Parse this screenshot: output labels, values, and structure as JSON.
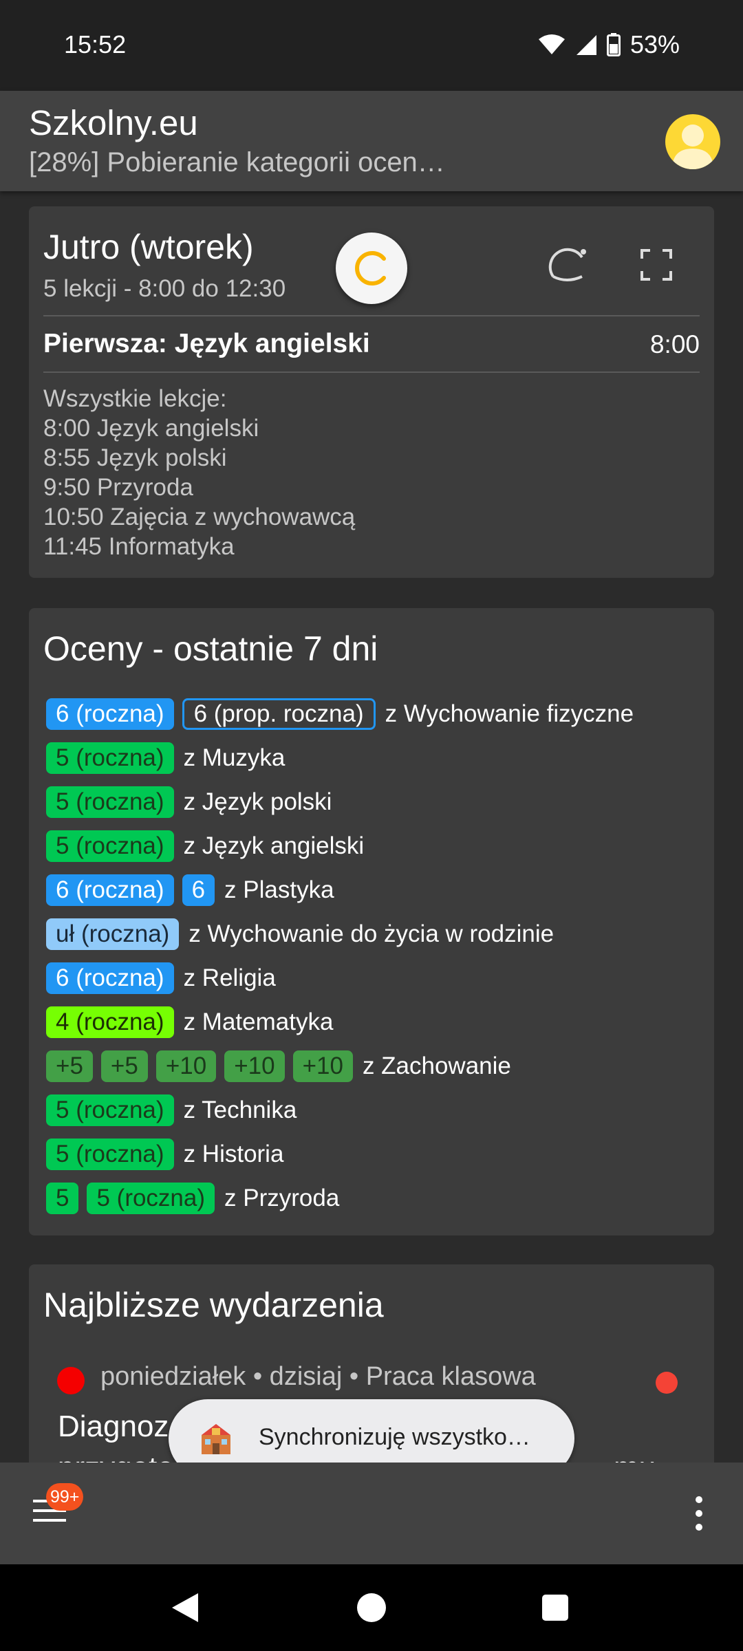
{
  "status_bar": {
    "time": "15:52",
    "battery": "53%"
  },
  "app_bar": {
    "title": "Szkolny.eu",
    "subtitle": "[28%] Pobieranie kategorii ocen…"
  },
  "timetable": {
    "title": "Jutro (wtorek)",
    "summary": "5 lekcji - 8:00 do 12:30",
    "first_label": "Pierwsza: Język angielski",
    "first_time": "8:00",
    "all_lessons_header": "Wszystkie lekcje:",
    "lessons": [
      "8:00 Język angielski",
      "8:55 Język polski",
      "9:50 Przyroda",
      "10:50 Zajęcia z wychowawcą",
      "11:45 Informatyka"
    ]
  },
  "grades": {
    "title": "Oceny - ostatnie 7 dni",
    "rows": [
      {
        "chips": [
          {
            "text": "6 (roczna)",
            "bg": "#2196f3",
            "fg": "#ffffff"
          },
          {
            "text": "6 (prop. roczna)",
            "bg": "outline",
            "fg": "#ffffff"
          }
        ],
        "subject": "z Wychowanie fizyczne"
      },
      {
        "chips": [
          {
            "text": "5 (roczna)",
            "bg": "#00c853",
            "fg": "#1b3a1b"
          }
        ],
        "subject": "z Muzyka"
      },
      {
        "chips": [
          {
            "text": "5 (roczna)",
            "bg": "#00c853",
            "fg": "#1b3a1b"
          }
        ],
        "subject": "z Język polski"
      },
      {
        "chips": [
          {
            "text": "5 (roczna)",
            "bg": "#00c853",
            "fg": "#1b3a1b"
          }
        ],
        "subject": "z Język angielski"
      },
      {
        "chips": [
          {
            "text": "6 (roczna)",
            "bg": "#2196f3",
            "fg": "#ffffff"
          },
          {
            "text": "6",
            "bg": "#2196f3",
            "fg": "#ffffff"
          }
        ],
        "subject": "z Plastyka"
      },
      {
        "chips": [
          {
            "text": "uł (roczna)",
            "bg": "#90caf9",
            "fg": "#1a2a3a"
          }
        ],
        "subject": "z Wychowanie do życia w rodzinie"
      },
      {
        "chips": [
          {
            "text": "6 (roczna)",
            "bg": "#2196f3",
            "fg": "#ffffff"
          }
        ],
        "subject": "z Religia"
      },
      {
        "chips": [
          {
            "text": "4 (roczna)",
            "bg": "#76ff03",
            "fg": "#1b2e05"
          }
        ],
        "subject": "z Matematyka"
      },
      {
        "chips": [
          {
            "text": "+5",
            "bg": "#43a047",
            "fg": "#1b3a1b"
          },
          {
            "text": "+5",
            "bg": "#43a047",
            "fg": "#1b3a1b"
          },
          {
            "text": "+10",
            "bg": "#43a047",
            "fg": "#1b3a1b"
          },
          {
            "text": "+10",
            "bg": "#43a047",
            "fg": "#1b3a1b"
          },
          {
            "text": "+10",
            "bg": "#43a047",
            "fg": "#1b3a1b"
          }
        ],
        "subject": "z Zachowanie"
      },
      {
        "chips": [
          {
            "text": "5 (roczna)",
            "bg": "#00c853",
            "fg": "#1b3a1b"
          }
        ],
        "subject": "z Technika"
      },
      {
        "chips": [
          {
            "text": "5 (roczna)",
            "bg": "#00c853",
            "fg": "#1b3a1b"
          }
        ],
        "subject": "z Historia"
      },
      {
        "chips": [
          {
            "text": "5",
            "bg": "#00c853",
            "fg": "#1b3a1b"
          },
          {
            "text": "5 (roczna)",
            "bg": "#00c853",
            "fg": "#1b3a1b"
          }
        ],
        "subject": "z Przyroda"
      }
    ]
  },
  "events": {
    "title": "Najbliższe wydarzenia",
    "item": {
      "meta": "poniedziałek • dzisiaj • Praca klasowa",
      "title_line1": "Diagnoz",
      "title_line2": "przygoto",
      "title_line2_end": "mu",
      "type_color": "#f50000"
    }
  },
  "toast": {
    "text": "Synchronizuję wszystko…"
  },
  "bottom_bar": {
    "badge": "99+"
  }
}
